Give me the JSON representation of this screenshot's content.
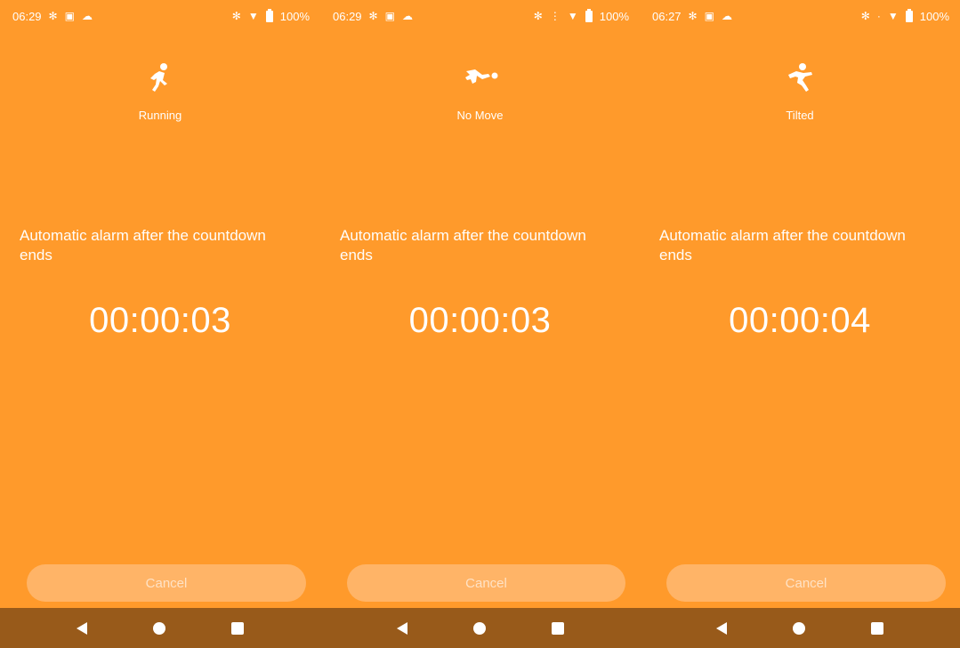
{
  "colors": {
    "background": "#FF9A2B",
    "cancel_button": "#FFB467",
    "cancel_text": "#FFE2C5",
    "nav_bar": "#985A1A",
    "text": "#FFFFFF"
  },
  "screens": [
    {
      "status": {
        "time": "06:29",
        "battery": "100%"
      },
      "mode_icon": "running-person-icon",
      "mode_label": "Running",
      "message": "Automatic alarm after the countdown ends",
      "countdown": "00:00:03",
      "cancel_label": "Cancel"
    },
    {
      "status": {
        "time": "06:29",
        "battery": "100%"
      },
      "mode_icon": "fallen-person-icon",
      "mode_label": "No Move",
      "message": "Automatic alarm after the countdown ends",
      "countdown": "00:00:03",
      "cancel_label": "Cancel"
    },
    {
      "status": {
        "time": "06:27",
        "battery": "100%"
      },
      "mode_icon": "tilted-person-icon",
      "mode_label": "Tilted",
      "message": "Automatic alarm after the countdown ends",
      "countdown": "00:00:04",
      "cancel_label": "Cancel"
    }
  ]
}
